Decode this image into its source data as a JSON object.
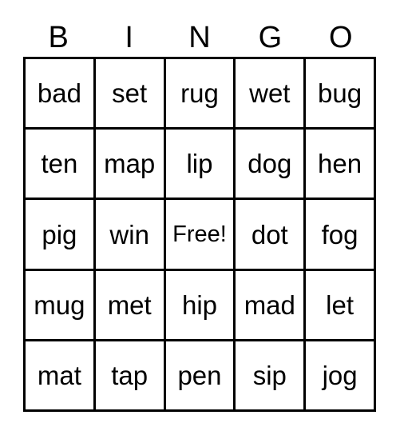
{
  "card": {
    "title": "BINGO",
    "header_letters": [
      "B",
      "I",
      "N",
      "G",
      "O"
    ],
    "free_space_label": "Free!",
    "colors": {
      "grid_line": "#000000",
      "text": "#000000",
      "background": "#ffffff"
    },
    "rows": [
      {
        "cells": [
          "bad",
          "set",
          "rug",
          "wet",
          "bug"
        ]
      },
      {
        "cells": [
          "ten",
          "map",
          "lip",
          "dog",
          "hen"
        ]
      },
      {
        "cells": [
          "pig",
          "win",
          "Free!",
          "dot",
          "fog"
        ]
      },
      {
        "cells": [
          "mug",
          "met",
          "hip",
          "mad",
          "let"
        ]
      },
      {
        "cells": [
          "mat",
          "tap",
          "pen",
          "sip",
          "jog"
        ]
      }
    ]
  }
}
